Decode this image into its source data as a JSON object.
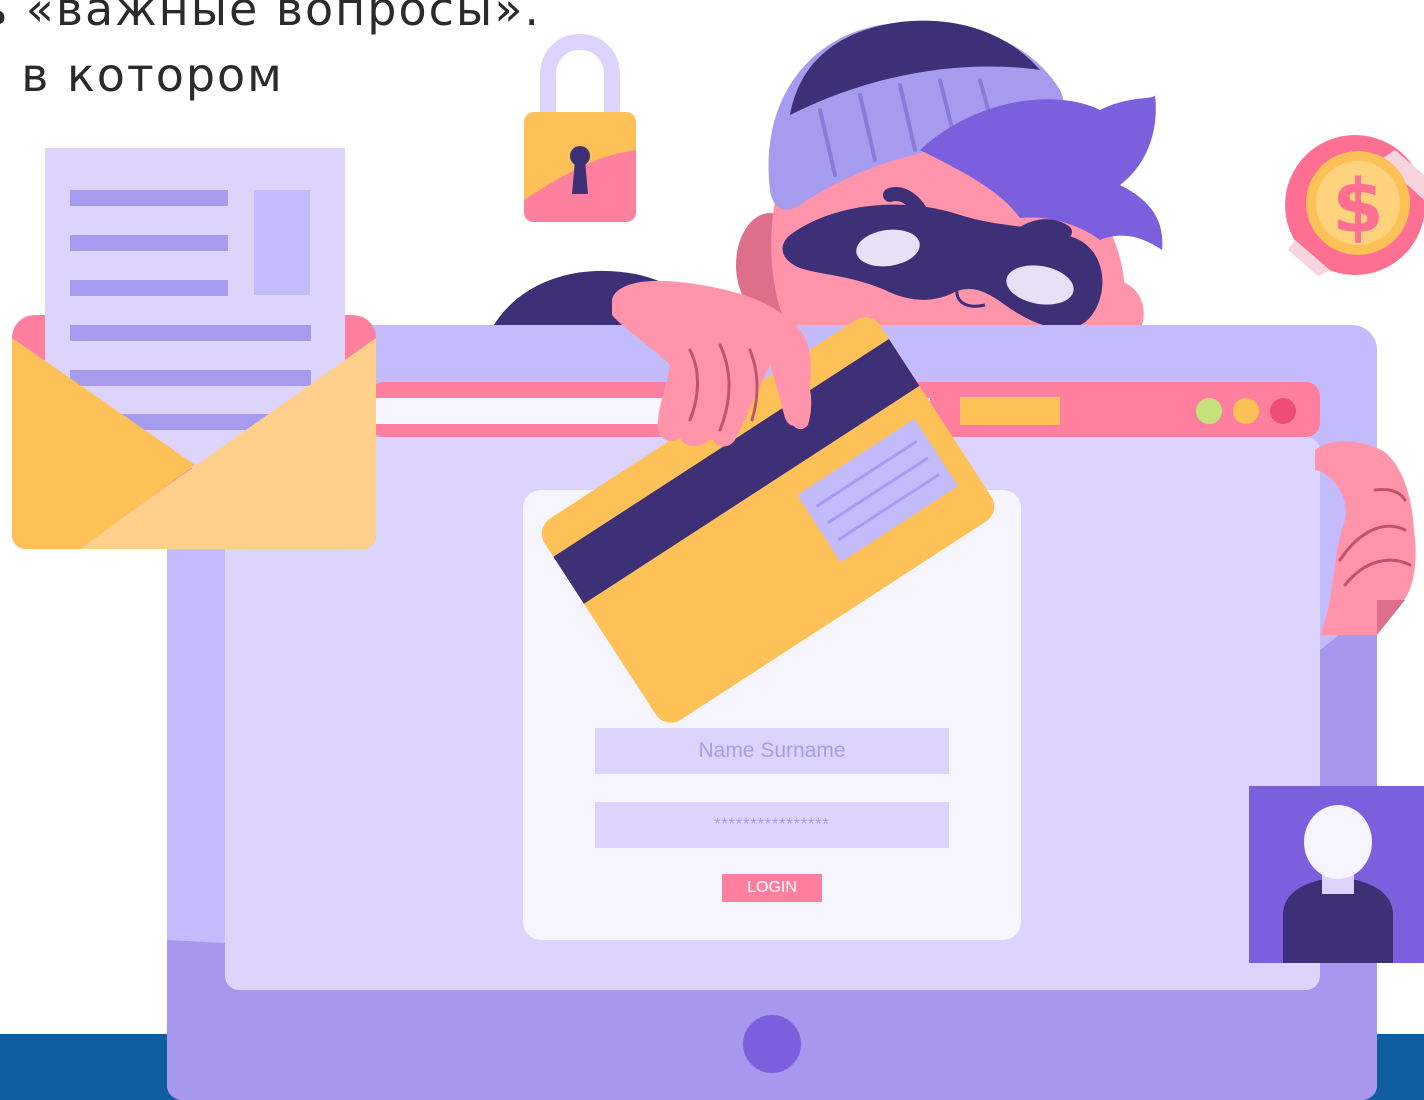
{
  "caption": {
    "line1": "ь «важные вопросы».",
    "line2": ", в котором"
  },
  "login_form": {
    "name_placeholder": "Name Surname",
    "password_mask": "****************",
    "login_label": "LOGIN"
  },
  "coin": {
    "symbol": "$"
  },
  "colors": {
    "background": "#ffffff",
    "bottom_band": "#0e5ea0",
    "monitor_frame": "#c4bbfc",
    "monitor_lower": "#a897ef",
    "screen": "#dcd4fd",
    "browser_bar": "#ff7f9f",
    "card_yellow": "#fec157",
    "card_stripe": "#3d3077",
    "skin_pink": "#ff94aa",
    "hat_lilac": "#a79bf0",
    "hair_purple": "#7b5fdc",
    "mask_dark": "#3d3077",
    "coin_pink": "#ff6f91",
    "coin_gold": "#ffd37e",
    "avatar_bg": "#7b5fdc"
  },
  "icons": {
    "padlock": "padlock-icon",
    "coin": "dollar-coin-icon",
    "envelope": "envelope-icon",
    "avatar": "user-avatar-icon",
    "credit_card": "credit-card-icon",
    "window_dots": "window-controls-icon",
    "home_button": "home-button-icon"
  }
}
